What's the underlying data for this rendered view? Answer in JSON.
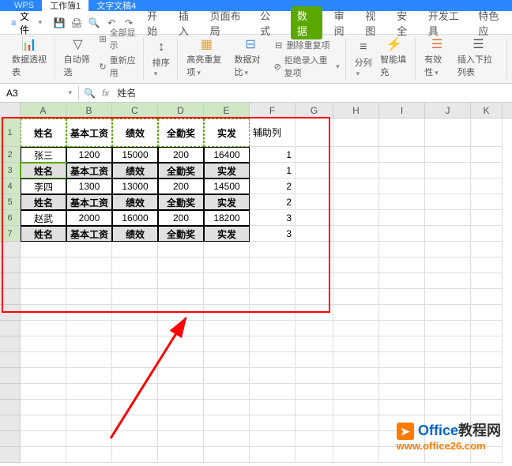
{
  "titlebar": {
    "wps": "WPS",
    "sheet_tab": "工作簿1",
    "doc_tab": "文字文稿4"
  },
  "menubar": {
    "file": "文件",
    "tabs": [
      "开始",
      "插入",
      "页面布局",
      "公式",
      "数据",
      "审阅",
      "视图",
      "安全",
      "开发工具",
      "特色应"
    ]
  },
  "ribbon": {
    "pivot": "数据透视表",
    "filter": "自动筛选",
    "show_all": "全部显示",
    "reapply": "重新应用",
    "sort": "排序",
    "highlight": "高亮重复项",
    "compare": "数据对比",
    "remove_dup": "删除重复项",
    "reject_dup": "拒绝录入重复项",
    "split": "分列",
    "smartfill": "智能填充",
    "validation": "有效性",
    "dropdown": "插入下拉列表"
  },
  "formula_bar": {
    "cell_ref": "A3",
    "fx": "fx",
    "value": "姓名"
  },
  "columns": [
    "A",
    "B",
    "C",
    "D",
    "E",
    "F",
    "G",
    "H",
    "I",
    "J",
    "K"
  ],
  "chart_data": {
    "type": "table",
    "headers": [
      "姓名",
      "基本工资",
      "绩效",
      "全勤奖",
      "实发",
      "辅助列"
    ],
    "rows": [
      {
        "name": "张三",
        "base": 1200,
        "perf": 15000,
        "bonus": 200,
        "total": 16400,
        "aux": 1
      },
      {
        "header_repeat": true,
        "aux": 1
      },
      {
        "name": "李四",
        "base": 1300,
        "perf": 13000,
        "bonus": 200,
        "total": 14500,
        "aux": 2
      },
      {
        "header_repeat": true,
        "aux": 2
      },
      {
        "name": "赵武",
        "base": 2000,
        "perf": 16000,
        "bonus": 200,
        "total": 18200,
        "aux": 3
      },
      {
        "header_repeat": true,
        "aux": 3
      }
    ]
  },
  "watermark": {
    "brand1": "Office",
    "brand2": "教程网",
    "url": "www.office26.com"
  },
  "col_widths": {
    "A": 58,
    "B": 58,
    "C": 58,
    "D": 58,
    "E": 58,
    "F": 58,
    "G": 48,
    "H": 58,
    "I": 58,
    "J": 58,
    "K": 40
  }
}
